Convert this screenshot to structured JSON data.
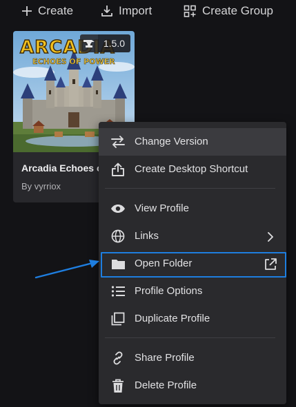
{
  "toolbar": {
    "create_label": "Create",
    "import_label": "Import",
    "create_group_label": "Create Group"
  },
  "profile_card": {
    "version": "1.5.0",
    "title": "Arcadia Echoes of",
    "author": "By vyrriox",
    "cover_logo": "ARCADIA",
    "cover_subtitle": "ECHOES OF POWER"
  },
  "context_menu": {
    "items": [
      {
        "label": "Change Version",
        "icon": "swap-arrows-icon"
      },
      {
        "label": "Create Desktop Shortcut",
        "icon": "share-upload-icon"
      },
      {
        "label": "View Profile",
        "icon": "eye-icon"
      },
      {
        "label": "Links",
        "icon": "globe-icon",
        "trailing": "chevron-right-icon"
      },
      {
        "label": "Open Folder",
        "icon": "folder-icon",
        "trailing": "external-link-icon"
      },
      {
        "label": "Profile Options",
        "icon": "list-icon"
      },
      {
        "label": "Duplicate Profile",
        "icon": "duplicate-icon"
      },
      {
        "label": "Share Profile",
        "icon": "link-icon"
      },
      {
        "label": "Delete Profile",
        "icon": "trash-icon"
      }
    ]
  },
  "colors": {
    "background": "#131316",
    "menu_background": "#2a2a2d",
    "menu_hover": "#3b3b3f",
    "highlight_border": "#1e7ee0"
  }
}
